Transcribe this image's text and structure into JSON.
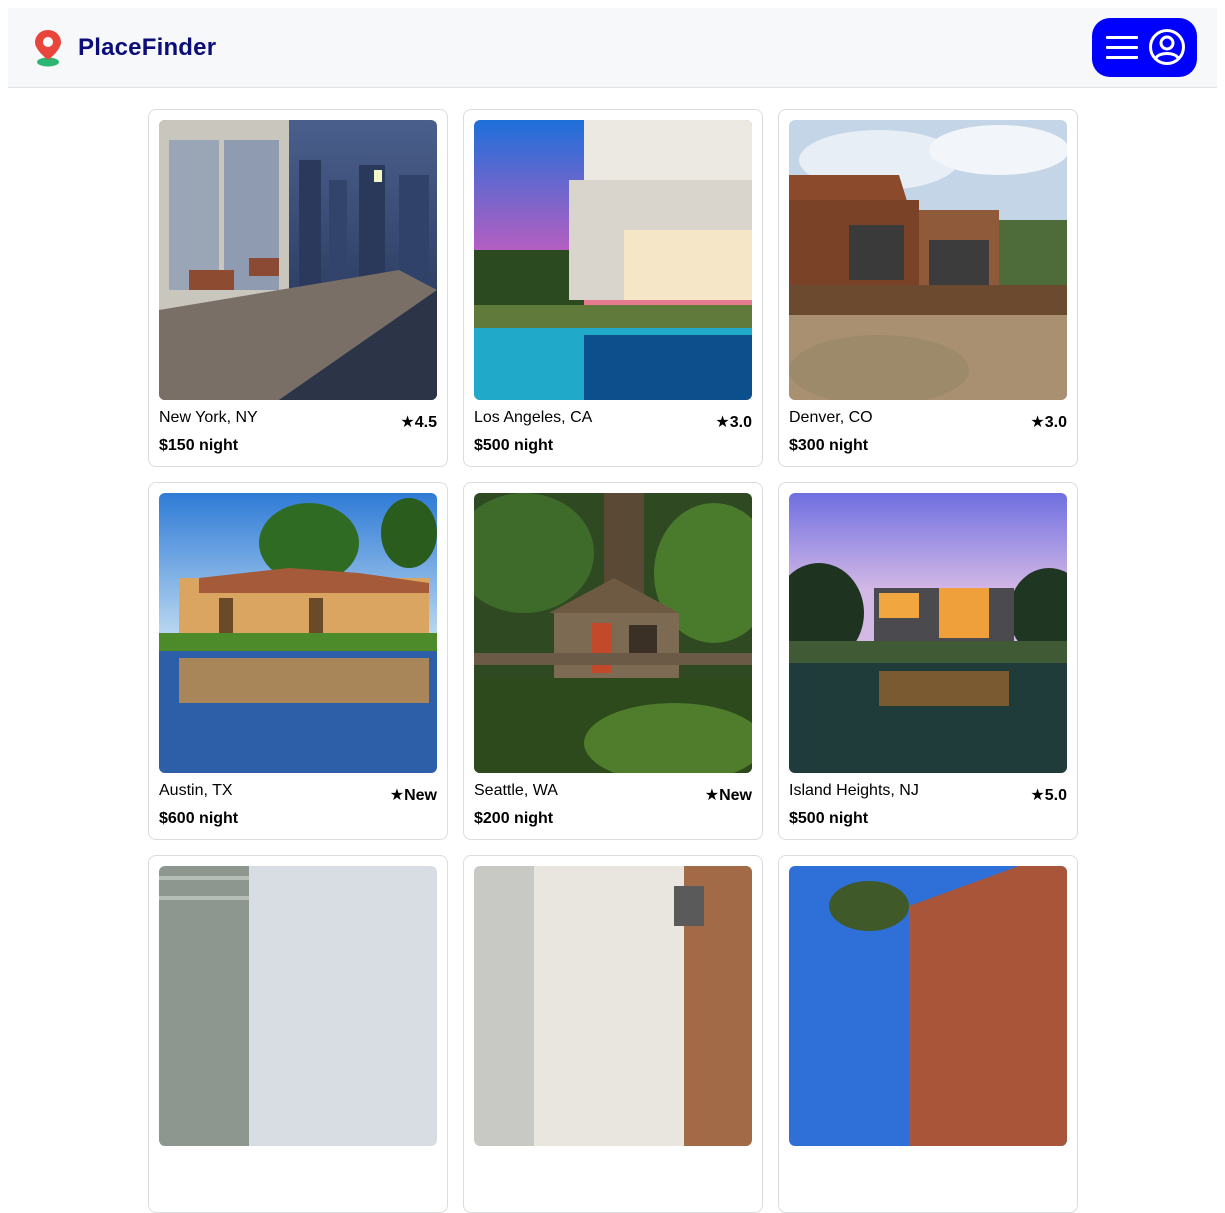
{
  "app": {
    "brand": "PlaceFinder"
  },
  "header": {
    "logo_icon": "map-pin-icon",
    "menu_icons": [
      "hamburger-icon",
      "user-circle-icon"
    ],
    "menu_color": "#0000ff"
  },
  "listings": [
    {
      "location": "New York, NY",
      "rating": "★4.5",
      "price": "$150 night",
      "photo": "city penthouse terrace at dusk"
    },
    {
      "location": "Los Angeles, CA",
      "rating": "★3.0",
      "price": "$500 night",
      "photo": "modern house with pool at sunset"
    },
    {
      "location": "Denver, CO",
      "rating": "★3.0",
      "price": "$300 night",
      "photo": "wooden cabin with deck"
    },
    {
      "location": "Austin, TX",
      "rating": "★New",
      "price": "$600 night",
      "photo": "villa reflected in lake"
    },
    {
      "location": "Seattle, WA",
      "rating": "★New",
      "price": "$200 night",
      "photo": "treehouse in forest"
    },
    {
      "location": "Island Heights, NJ",
      "rating": "★5.0",
      "price": "$500 night",
      "photo": "modern house with pool at twilight"
    },
    {
      "location": "",
      "rating": "",
      "price": "",
      "photo": "house exterior"
    },
    {
      "location": "",
      "rating": "",
      "price": "",
      "photo": "brick colonial house"
    },
    {
      "location": "",
      "rating": "",
      "price": "",
      "photo": "brick house with tree"
    }
  ]
}
